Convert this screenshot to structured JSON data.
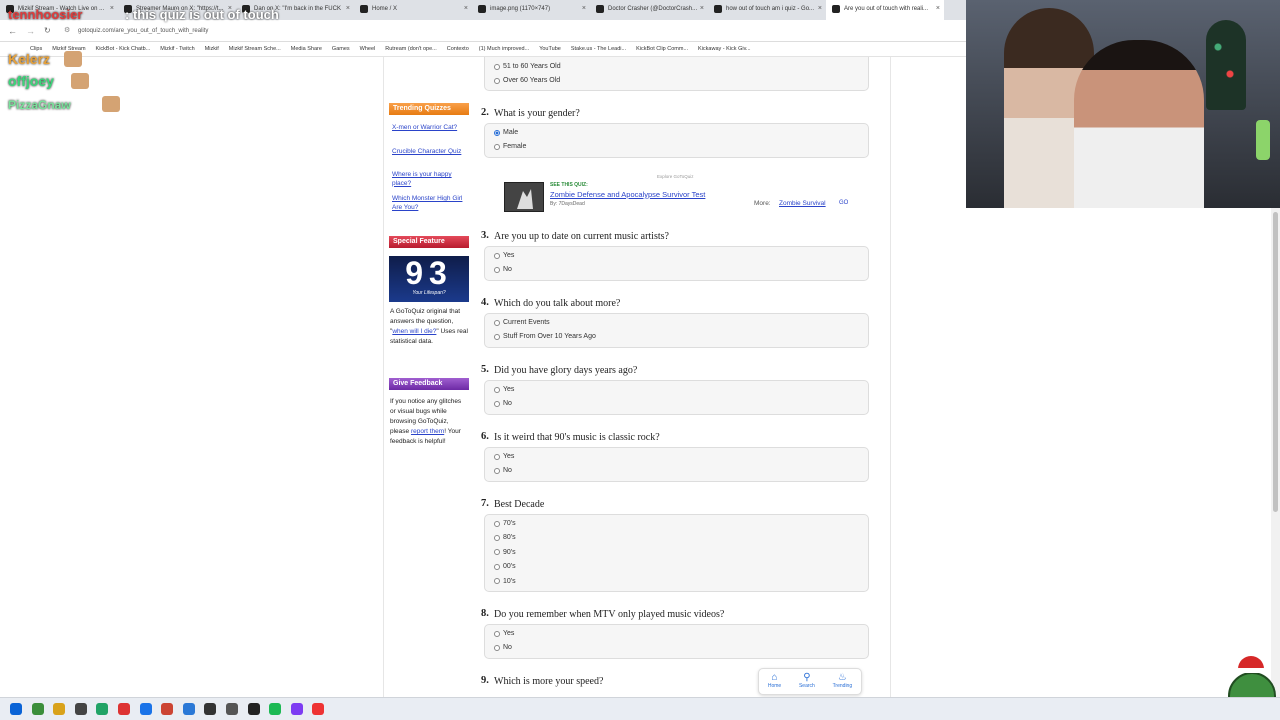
{
  "browser": {
    "tabs": [
      {
        "label": "Mizkif Stream - Watch Live on ...",
        "active": false
      },
      {
        "label": "Streamer Mauro on X: \"https://t...",
        "active": false
      },
      {
        "label": "Dan on X: \"I'm back in the FUCK",
        "active": false
      },
      {
        "label": "Home / X",
        "active": false
      },
      {
        "label": "image.png (1170×747)",
        "active": false
      },
      {
        "label": "Doctor Crasher (@DoctorCrash...",
        "active": false
      },
      {
        "label": "how out of touch am i quiz - Go...",
        "active": false
      },
      {
        "label": "Are you out of touch with reali...",
        "active": true
      }
    ],
    "url": "gotoquiz.com/are_you_out_of_touch_with_reality",
    "bookmarks": [
      "Clips",
      "Mizkif Stream",
      "KickBot - Kick Chatb...",
      "Mizkif - Twitch",
      "Mizkif",
      "Mizkif Stream Sche...",
      "Media Share",
      "Games",
      "Wheel",
      "Rutream (don't ope...",
      "Contexto",
      "(1) Much improved...",
      "YouTube",
      "Stake.us - The Leadi...",
      "KickBot Clip Comm...",
      "Kickaway - Kick Giv..."
    ]
  },
  "chat_overlay": {
    "messages": [
      {
        "user": "tennhoosier",
        "text": ": this quiz is out of touch",
        "color": "#e23b3b"
      },
      {
        "user": "Kelerz",
        "text": "",
        "color": "#e8a23a"
      },
      {
        "user": "offjoey",
        "text": "",
        "color": "#3bd67a"
      },
      {
        "user": "PizzaGnaw",
        "text": "",
        "color": "#7ae39c"
      }
    ]
  },
  "sidebar": {
    "trending_title": "Trending Quizzes",
    "trending": [
      "X-men or Warrior Cat?",
      "Crucible Character Quiz",
      "Where is your happy place?",
      "Which Monster High Girl Are You?"
    ],
    "special_title": "Special Feature",
    "special_number": "93",
    "special_caption": "Your Lifespan?",
    "special_text_before": "A GoToQuiz original that answers the question, \"",
    "special_link": "when will I die?",
    "special_text_after": "\" Uses real statistical data.",
    "feedback_title": "Give Feedback",
    "feedback_text_before": "If you notice any glitches or visual bugs while browsing GoToQuiz, please ",
    "feedback_link": "report them",
    "feedback_text_after": "! Your feedback is helpful!"
  },
  "quiz": {
    "q1_tail_options": [
      "51 to 60 Years Old",
      "Over 60 Years Old"
    ],
    "questions": [
      {
        "num": "2.",
        "text": "What is your gender?",
        "options": [
          "Male",
          "Female"
        ],
        "selected": 0
      },
      {
        "num": "3.",
        "text": "Are you up to date on current music artists?",
        "options": [
          "Yes",
          "No"
        ],
        "selected": -1
      },
      {
        "num": "4.",
        "text": "Which do you talk about more?",
        "options": [
          "Current Events",
          "Stuff From Over 10 Years Ago"
        ],
        "selected": -1
      },
      {
        "num": "5.",
        "text": "Did you have glory days years ago?",
        "options": [
          "Yes",
          "No"
        ],
        "selected": -1
      },
      {
        "num": "6.",
        "text": "Is it weird that 90's music is classic rock?",
        "options": [
          "Yes",
          "No"
        ],
        "selected": -1
      },
      {
        "num": "7.",
        "text": "Best Decade",
        "options": [
          "70's",
          "80's",
          "90's",
          "00's",
          "10's"
        ],
        "selected": -1
      },
      {
        "num": "8.",
        "text": "Do you remember when MTV only played music videos?",
        "options": [
          "Yes",
          "No"
        ],
        "selected": -1
      },
      {
        "num": "9.",
        "text": "Which is more your speed?",
        "options": [],
        "selected": -1
      }
    ]
  },
  "see_quiz": {
    "explore": "Explore GoToQuiz",
    "label": "SEE THIS QUIZ:",
    "title": "Zombie Defense and Apocalypse Survivor Test",
    "by": "By: 7DaysDead",
    "more_label": "More:",
    "more_link": "Zombie Survival"
  },
  "bottom_nav": {
    "home": "Home",
    "search": "Search",
    "trending": "Trending"
  }
}
